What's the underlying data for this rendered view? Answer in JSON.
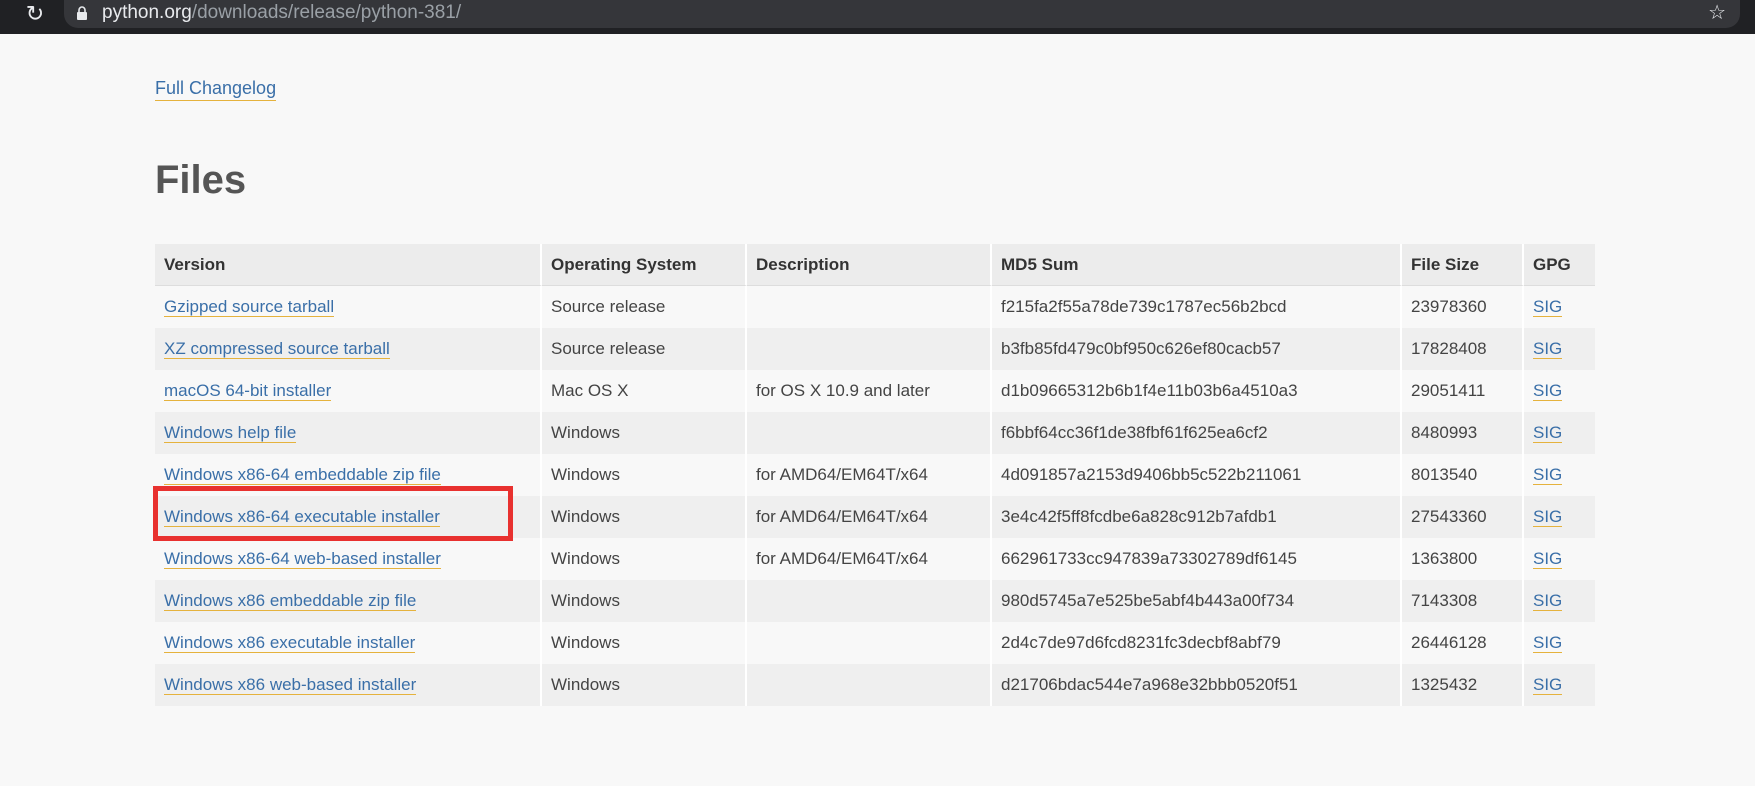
{
  "browser": {
    "url_host": "python.org",
    "url_path": "/downloads/release/python-381/"
  },
  "page": {
    "changelog_link": "Full Changelog",
    "files_heading": "Files"
  },
  "table": {
    "headers": [
      "Version",
      "Operating System",
      "Description",
      "MD5 Sum",
      "File Size",
      "GPG"
    ],
    "rows": [
      {
        "version": "Gzipped source tarball",
        "os": "Source release",
        "description": "",
        "md5": "f215fa2f55a78de739c1787ec56b2bcd",
        "size": "23978360",
        "gpg": "SIG"
      },
      {
        "version": "XZ compressed source tarball",
        "os": "Source release",
        "description": "",
        "md5": "b3fb85fd479c0bf950c626ef80cacb57",
        "size": "17828408",
        "gpg": "SIG"
      },
      {
        "version": "macOS 64-bit installer",
        "os": "Mac OS X",
        "description": "for OS X 10.9 and later",
        "md5": "d1b09665312b6b1f4e11b03b6a4510a3",
        "size": "29051411",
        "gpg": "SIG"
      },
      {
        "version": "Windows help file",
        "os": "Windows",
        "description": "",
        "md5": "f6bbf64cc36f1de38fbf61f625ea6cf2",
        "size": "8480993",
        "gpg": "SIG"
      },
      {
        "version": "Windows x86-64 embeddable zip file",
        "os": "Windows",
        "description": "for AMD64/EM64T/x64",
        "md5": "4d091857a2153d9406bb5c522b211061",
        "size": "8013540",
        "gpg": "SIG"
      },
      {
        "version": "Windows x86-64 executable installer",
        "os": "Windows",
        "description": "for AMD64/EM64T/x64",
        "md5": "3e4c42f5ff8fcdbe6a828c912b7afdb1",
        "size": "27543360",
        "gpg": "SIG"
      },
      {
        "version": "Windows x86-64 web-based installer",
        "os": "Windows",
        "description": "for AMD64/EM64T/x64",
        "md5": "662961733cc947839a73302789df6145",
        "size": "1363800",
        "gpg": "SIG"
      },
      {
        "version": "Windows x86 embeddable zip file",
        "os": "Windows",
        "description": "",
        "md5": "980d5745a7e525be5abf4b443a00f734",
        "size": "7143308",
        "gpg": "SIG"
      },
      {
        "version": "Windows x86 executable installer",
        "os": "Windows",
        "description": "",
        "md5": "2d4c7de97d6fcd8231fc3decbf8abf79",
        "size": "26446128",
        "gpg": "SIG"
      },
      {
        "version": "Windows x86 web-based installer",
        "os": "Windows",
        "description": "",
        "md5": "d21706bdac544e7a968e32bbb0520f51",
        "size": "1325432",
        "gpg": "SIG"
      }
    ]
  },
  "colors": {
    "link": "#3a6fa8",
    "link_underline": "#e5b23d",
    "highlight": "#e8312f"
  }
}
